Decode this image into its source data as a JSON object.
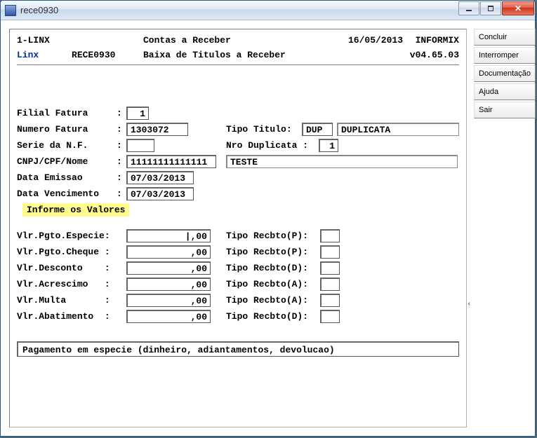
{
  "window": {
    "title": "rece0930"
  },
  "sidebar": {
    "concluir": "Concluir",
    "interromper": "Interromper",
    "documentacao": "Documentação",
    "ajuda": "Ajuda",
    "sair": "Sair"
  },
  "header": {
    "line1": {
      "company": "1-LINX",
      "module": "Contas a Receber",
      "date": "16/05/2013",
      "db": "INFORMIX"
    },
    "line2": {
      "brand": "Linx",
      "program": "RECE0930",
      "subtitle": "Baixa de Titulos a Receber",
      "version": "v04.65.03"
    }
  },
  "labels": {
    "filial": "Filial Fatura",
    "numero": "Numero Fatura",
    "tipo_titulo": "Tipo Titulo:",
    "serie": "Serie da N.F.",
    "nro_dup": "Nro Duplicata :",
    "cnpj": "CNPJ/CPF/Nome",
    "emissao": "Data Emissao",
    "vencimento": "Data Vencimento",
    "informe": "Informe os Valores",
    "vlr_especie": "Vlr.Pgto.Especie:",
    "vlr_cheque": "Vlr.Pgto.Cheque :",
    "vlr_desconto": "Vlr.Desconto",
    "vlr_acrescimo": "Vlr.Acrescimo",
    "vlr_multa": "Vlr.Multa",
    "vlr_abatimento": "Vlr.Abatimento",
    "tipo_p": "Tipo Recbto(P):",
    "tipo_d": "Tipo Recbto(D):",
    "tipo_a": "Tipo Recbto(A):"
  },
  "fields": {
    "filial": "1",
    "numero": "1303072",
    "tipo_titulo_cod": "DUP",
    "tipo_titulo_desc": "DUPLICATA",
    "serie": "",
    "nro_dup": "1",
    "cnpj": "11111111111111",
    "nome": "TESTE",
    "emissao": "07/03/2013",
    "vencimento": "07/03/2013",
    "vlr_especie": "|,00",
    "vlr_cheque": ",00",
    "vlr_desconto": ",00",
    "vlr_acrescimo": ",00",
    "vlr_multa": ",00",
    "vlr_abatimento": ",00",
    "tipo_p1": "",
    "tipo_p2": "",
    "tipo_d1": "",
    "tipo_a1": "",
    "tipo_a2": "",
    "tipo_d2": ""
  },
  "footer": "Pagamento em especie (dinheiro, adiantamentos, devolucao)"
}
